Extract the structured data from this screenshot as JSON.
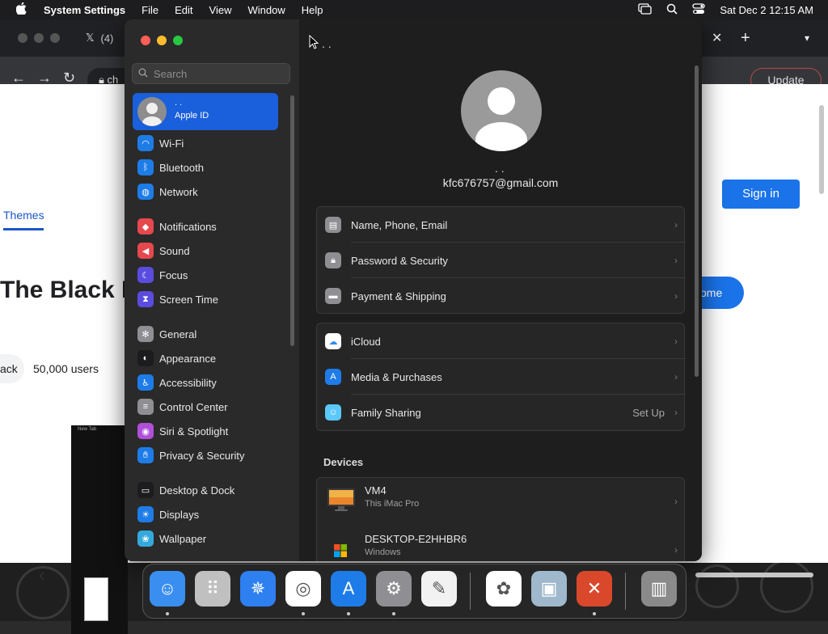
{
  "menubar": {
    "apple": "",
    "app_name": "System Settings",
    "items": [
      "File",
      "Edit",
      "View",
      "Window",
      "Help"
    ],
    "clock": "Sat Dec 2  12:15 AM",
    "status_icons": [
      "screen-mirroring-icon",
      "spotlight-icon",
      "control-center-icon"
    ]
  },
  "browser": {
    "tab_title": "(4)",
    "url_fragment": "ch",
    "update_label": "Update",
    "themes_tab": "Themes",
    "heading_fragment": "The Black I",
    "pill_fragment": "ack",
    "users_count": "50,000 users",
    "sign_in": "Sign in",
    "pill_right": "ome",
    "thumb_tab": "New Tab"
  },
  "settings": {
    "search_placeholder": "Search",
    "apple_id": {
      "name": ". .",
      "label": "Apple ID"
    },
    "sidebar": [
      {
        "label": "Wi-Fi",
        "icon": "wifi-icon",
        "color": "#1e7ce8"
      },
      {
        "label": "Bluetooth",
        "icon": "bluetooth-icon",
        "color": "#1e7ce8"
      },
      {
        "label": "Network",
        "icon": "globe-icon",
        "color": "#1e7ce8"
      },
      {
        "label": "Notifications",
        "icon": "bell-icon",
        "color": "#e5484d"
      },
      {
        "label": "Sound",
        "icon": "speaker-icon",
        "color": "#e5484d"
      },
      {
        "label": "Focus",
        "icon": "moon-icon",
        "color": "#5b4ce0"
      },
      {
        "label": "Screen Time",
        "icon": "hourglass-icon",
        "color": "#5b4ce0"
      },
      {
        "label": "General",
        "icon": "gear-icon",
        "color": "#8e8e93"
      },
      {
        "label": "Appearance",
        "icon": "appearance-icon",
        "color": "#1c1c1e"
      },
      {
        "label": "Accessibility",
        "icon": "accessibility-icon",
        "color": "#1e7ce8"
      },
      {
        "label": "Control Center",
        "icon": "control-center-icon",
        "color": "#8e8e93"
      },
      {
        "label": "Siri & Spotlight",
        "icon": "siri-icon",
        "color": "#b04fd8"
      },
      {
        "label": "Privacy & Security",
        "icon": "hand-icon",
        "color": "#1e7ce8"
      },
      {
        "label": "Desktop & Dock",
        "icon": "dock-icon",
        "color": "#1c1c1e"
      },
      {
        "label": "Displays",
        "icon": "sun-icon",
        "color": "#1e7ce8"
      },
      {
        "label": "Wallpaper",
        "icon": "wallpaper-icon",
        "color": "#34aadc"
      }
    ],
    "main": {
      "title": ". .",
      "account_name": ". .",
      "email": "kfc676757@gmail.com",
      "account_rows": [
        {
          "label": "Name, Phone, Email",
          "icon": "contact-card-icon",
          "color": "#8e8e93"
        },
        {
          "label": "Password & Security",
          "icon": "lock-icon",
          "color": "#8e8e93"
        },
        {
          "label": "Payment & Shipping",
          "icon": "credit-card-icon",
          "color": "#8e8e93"
        }
      ],
      "service_rows": [
        {
          "label": "iCloud",
          "icon": "cloud-icon",
          "color": "#ffffff"
        },
        {
          "label": "Media & Purchases",
          "icon": "app-store-icon",
          "color": "#1e7ce8"
        },
        {
          "label": "Family Sharing",
          "icon": "family-icon",
          "color": "#5ac8fa",
          "value": "Set Up"
        }
      ],
      "devices_header": "Devices",
      "devices": [
        {
          "name": "VM4",
          "detail": "This iMac Pro",
          "icon": "imac-icon"
        },
        {
          "name": "DESKTOP-E2HHBR6",
          "detail": "Windows",
          "icon": "windows-icon"
        }
      ]
    }
  },
  "dock": [
    {
      "name": "finder-icon",
      "color": "#3a8ef0",
      "running": true
    },
    {
      "name": "launchpad-icon",
      "color": "#c0c0c0",
      "running": false
    },
    {
      "name": "safari-icon",
      "color": "#2e7ff0",
      "running": false
    },
    {
      "name": "chrome-icon",
      "color": "#ffffff",
      "running": true
    },
    {
      "name": "app-store-icon",
      "color": "#1e7ce8",
      "running": true
    },
    {
      "name": "system-settings-icon",
      "color": "#8e8e93",
      "running": true
    },
    {
      "name": "textedit-icon",
      "color": "#f2f2f2",
      "running": false
    },
    {
      "name": "photos-icon",
      "color": "#ffffff",
      "running": false
    },
    {
      "name": "preview-icon",
      "color": "#9fb8cc",
      "running": false
    },
    {
      "name": "remote-desktop-icon",
      "color": "#d9482b",
      "running": true
    },
    {
      "name": "trash-icon",
      "color": "#8a8a8a",
      "running": false
    }
  ]
}
